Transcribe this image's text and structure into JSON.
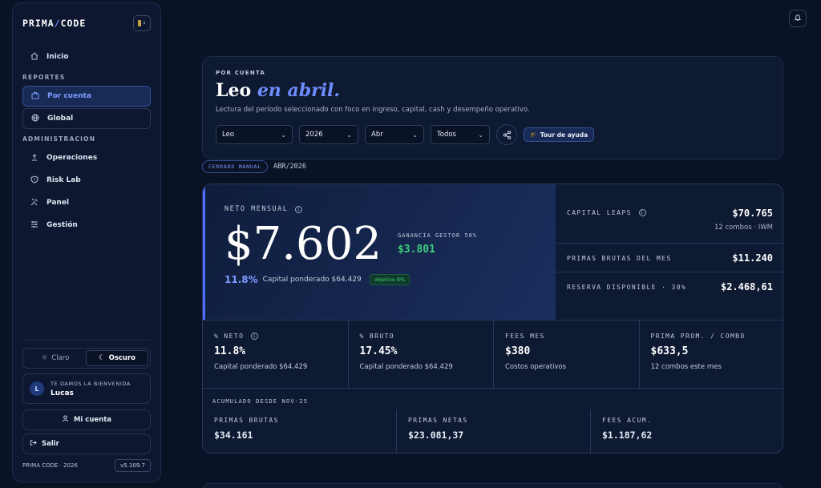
{
  "sidebar": {
    "brand_left": "PRIMA",
    "brand_sep": "/",
    "brand_right": "CODE",
    "nav_home": "Inicio",
    "section_reports": "REPORTES",
    "nav_por_cuenta": "Por cuenta",
    "nav_global": "Global",
    "section_admin": "ADMINISTRACION",
    "nav_operaciones": "Operaciones",
    "nav_risklab": "Risk Lab",
    "nav_panel": "Panel",
    "nav_gestion": "Gestión",
    "theme_light": "Claro",
    "theme_dark": "Oscuro",
    "welcome_label": "TE DAMOS LA BIENVENIDA",
    "user_initial": "L",
    "user_name": "Lucas",
    "account_btn": "Mi cuenta",
    "logout_btn": "Salir",
    "copyright": "PRIMA CODE · 2026",
    "version": "v5.109.7"
  },
  "header": {
    "eyebrow": "POR CUENTA",
    "title_name": "Leo",
    "title_period": "en abril.",
    "subtitle": "Lectura del período seleccionado con foco en ingreso, capital, cash y desempeño operativo.",
    "filter_account": "Leo",
    "filter_year": "2026",
    "filter_month": "Abr",
    "filter_scope": "Todos",
    "tour_btn": "Tour de ayuda"
  },
  "status": {
    "pill": "CERRADO MANUAL",
    "period": "ABR/2026"
  },
  "hero": {
    "label": "NETO MENSUAL",
    "value": "$7.602",
    "gain_label": "GANANCIA GESTOR 50%",
    "gain_value": "$3.801",
    "pct": "11.8%",
    "cap_text": "Capital ponderado $64.429",
    "objective": "objetivo 8%"
  },
  "side": {
    "leaps_label": "CAPITAL LEAPS",
    "leaps_value": "$70.765",
    "leaps_note": "12 combos · IWM",
    "primas_label": "PRIMAS BRUTAS DEL MES",
    "primas_value": "$11.240",
    "reserva_label": "RESERVA DISPONIBLE · 30%",
    "reserva_value": "$2.468,61"
  },
  "metrics": [
    {
      "label": "% NETO",
      "value": "11.8%",
      "sub": "Capital ponderado $64.429"
    },
    {
      "label": "% BRUTO",
      "value": "17.45%",
      "sub": "Capital ponderado $64.429"
    },
    {
      "label": "FEES MES",
      "value": "$380",
      "sub": "Costos operativos"
    },
    {
      "label": "PRIMA PROM. / COMBO",
      "value": "$633,5",
      "sub": "12 combos este mes"
    }
  ],
  "accum": {
    "title": "ACUMULADO DESDE NOV-25",
    "cols": [
      {
        "label": "PRIMAS BRUTAS",
        "value": "$34.161"
      },
      {
        "label": "PRIMAS NETAS",
        "value": "$23.081,37"
      },
      {
        "label": "FEES ACUM.",
        "value": "$1.187,62"
      }
    ]
  }
}
